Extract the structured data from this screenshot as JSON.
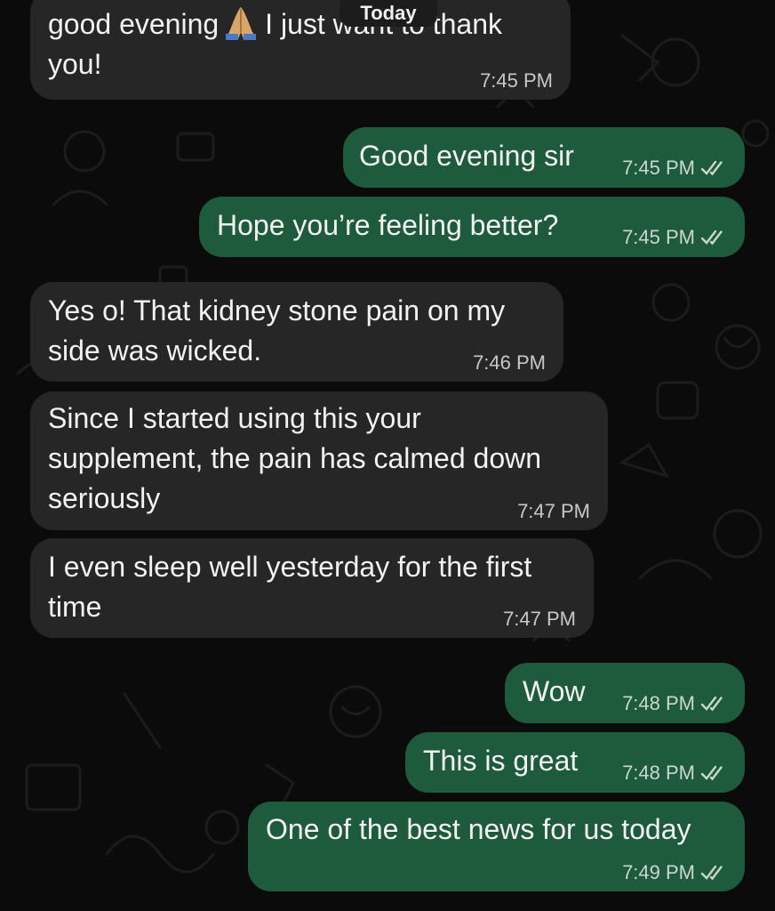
{
  "date_separator": "Today",
  "messages": [
    {
      "direction": "in",
      "lines": [
        "good evening",
        "I just want to thank",
        "you!"
      ],
      "time": "7:45 PM",
      "emoji": "folded-hands"
    },
    {
      "direction": "out",
      "text": "Good evening sir",
      "time": "7:45 PM",
      "status": "read"
    },
    {
      "direction": "out",
      "text": "Hope you’re feeling better?",
      "time": "7:45 PM",
      "status": "read"
    },
    {
      "direction": "in",
      "lines": [
        "Yes o! That kidney stone pain on my",
        "side was wicked."
      ],
      "time": "7:46 PM"
    },
    {
      "direction": "in",
      "lines": [
        "Since I started using this your",
        "supplement, the pain has calmed down",
        "seriously"
      ],
      "time": "7:47 PM"
    },
    {
      "direction": "in",
      "lines": [
        "I even sleep well yesterday for the first",
        "time"
      ],
      "time": "7:47 PM"
    },
    {
      "direction": "out",
      "text": "Wow",
      "time": "7:48 PM",
      "status": "read"
    },
    {
      "direction": "out",
      "text": "This is great",
      "time": "7:48 PM",
      "status": "read"
    },
    {
      "direction": "out",
      "text": "One of the best news for us today",
      "time": "7:49 PM",
      "status": "read"
    }
  ],
  "colors": {
    "background": "#0b0b0b",
    "incoming_bubble": "#262626",
    "outgoing_bubble": "#1e5a3c",
    "text": "#f2f2f2",
    "timestamp": "#c8c8c8"
  },
  "icons": {
    "read_receipt": "double-check-icon",
    "emoji": "folded-hands-emoji"
  }
}
